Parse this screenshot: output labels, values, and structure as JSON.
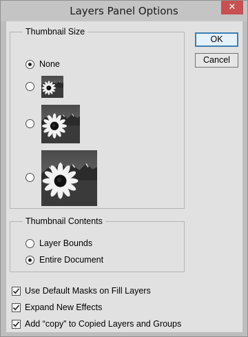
{
  "window": {
    "title": "Layers Panel Options",
    "close_glyph": "✕"
  },
  "buttons": {
    "ok_label": "OK",
    "cancel_label": "Cancel"
  },
  "thumbnail_size": {
    "legend": "Thumbnail Size",
    "options": [
      {
        "label": "None",
        "selected": true
      },
      {
        "label": "",
        "size": "small",
        "selected": false
      },
      {
        "label": "",
        "size": "medium",
        "selected": false
      },
      {
        "label": "",
        "size": "large",
        "selected": false
      }
    ]
  },
  "thumbnail_contents": {
    "legend": "Thumbnail Contents",
    "options": [
      {
        "label": "Layer Bounds",
        "selected": false
      },
      {
        "label": "Entire Document",
        "selected": true
      }
    ]
  },
  "checkboxes": [
    {
      "label": "Use Default Masks on Fill Layers",
      "checked": true
    },
    {
      "label": "Expand New Effects",
      "checked": true
    },
    {
      "label": "Add “copy” to Copied Layers and Groups",
      "checked": true
    }
  ]
}
